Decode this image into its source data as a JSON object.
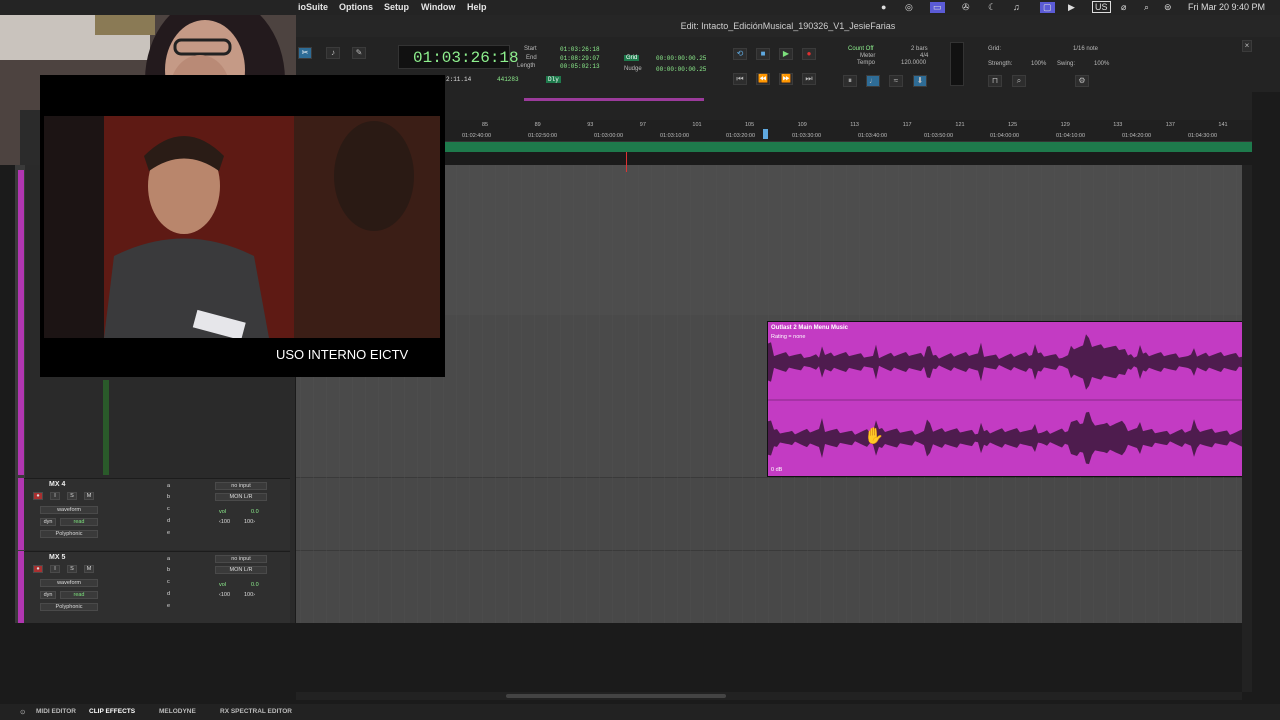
{
  "menubar": {
    "items": [
      "ioSuite",
      "Options",
      "Setup",
      "Window",
      "Help"
    ],
    "status": {
      "input_source": "US",
      "datetime": "Fri Mar 20  9:40 PM"
    }
  },
  "window_title": "Edit: Intacto_EdiciónMusical_190326_V1_JesieFarias",
  "transport": {
    "main_counter": "01:03:26:18",
    "start_label": "Start",
    "start": "01:03:26:18",
    "end_label": "End",
    "end": "01:08:29:07",
    "length_label": "Length",
    "length": "00:05:02:13",
    "grid_label": "Grid",
    "grid_value": "00:00:00:00.25",
    "nudge_label": "Nudge",
    "nudge_value": "00:00:00:00.25",
    "pre_roll": "2:11.14",
    "samples": "441283",
    "dly_label": "Dly",
    "count_off": "Count Off",
    "meter_label": "Meter",
    "tempo_label": "Tempo",
    "bars": "2 bars",
    "meter": "4/4",
    "tempo": "120.0000",
    "grid2_label": "Grid:",
    "grid2_value": "1/16 note",
    "strength_label": "Strength:",
    "strength_value": "100%",
    "swing_label": "Swing:",
    "swing_value": "100%"
  },
  "ruler": {
    "bars": [
      "85",
      "89",
      "93",
      "97",
      "101",
      "105",
      "109",
      "113",
      "117",
      "121",
      "125",
      "129",
      "133",
      "137",
      "141"
    ],
    "timecodes": [
      "01:02:40:00",
      "01:02:50:00",
      "01:03:00:00",
      "01:03:10:00",
      "01:03:20:00",
      "01:03:30:00",
      "01:03:40:00",
      "01:03:50:00",
      "01:04:00:00",
      "01:04:10:00",
      "01:04:20:00",
      "01:04:30:00"
    ]
  },
  "clip": {
    "name": "Outlast 2 Main Menu Music",
    "rating": "Rating = none",
    "gain": "0 dB"
  },
  "tracks": [
    {
      "name": "MX 4",
      "view": "waveform",
      "dyn": "dyn",
      "read": "read",
      "plugin": "Polyphonic",
      "input": "no input",
      "output": "MON L/R",
      "vol": "vol",
      "vol_value": "0.0",
      "pan_l": "‹100",
      "pan_r": "100›",
      "sends": [
        "a",
        "b",
        "c",
        "d",
        "e"
      ]
    },
    {
      "name": "MX 5",
      "view": "waveform",
      "dyn": "dyn",
      "read": "read",
      "plugin": "Polyphonic",
      "input": "no input",
      "output": "MON L/R",
      "vol": "vol",
      "vol_value": "0.0",
      "pan_l": "‹100",
      "pan_r": "100›",
      "sends": [
        "a",
        "b",
        "c",
        "d",
        "e"
      ]
    }
  ],
  "video": {
    "watermark": "USO INTERNO EICTV"
  },
  "bottom_tabs": [
    "MIDI EDITOR",
    "CLIP EFFECTS",
    "MELODYNE",
    "RX SPECTRAL EDITOR"
  ],
  "colors": {
    "clip": "#c33bc3",
    "track_accent": "#b136b1",
    "counter_text": "#8ef08e",
    "marker_lane": "#1e7a4c"
  }
}
